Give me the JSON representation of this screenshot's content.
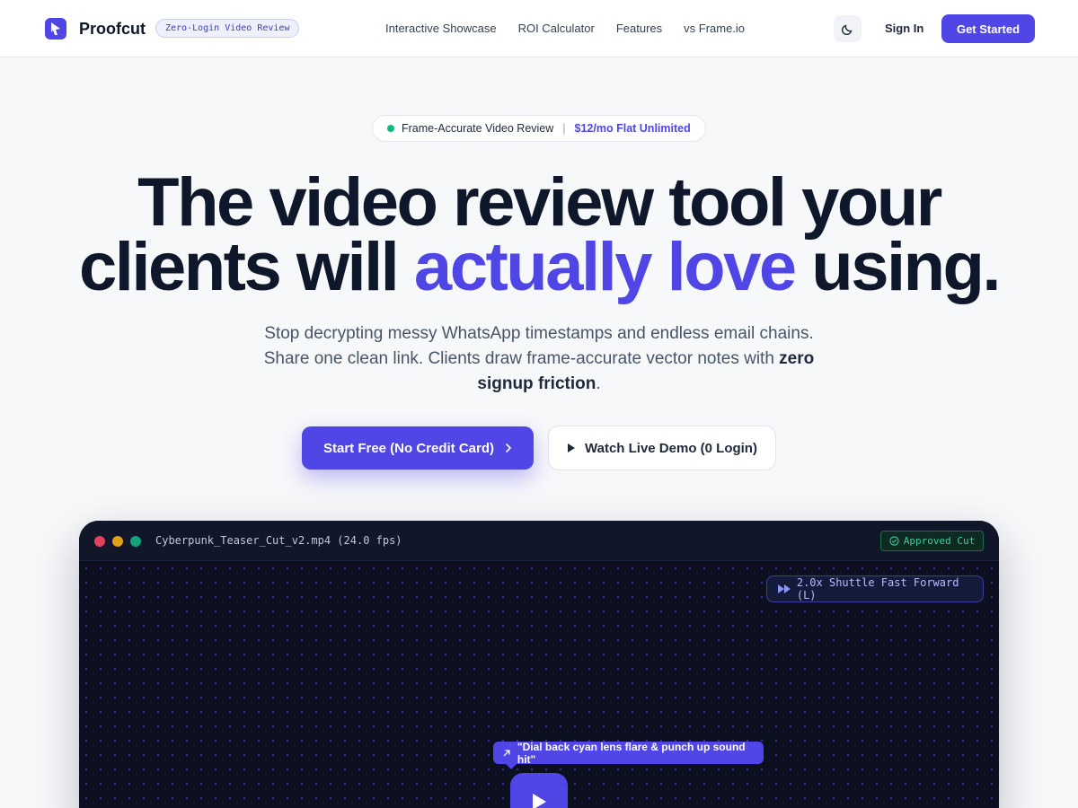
{
  "nav": {
    "brand": "Proofcut",
    "badge": "Zero-Login Video Review",
    "links": [
      "Interactive Showcase",
      "ROI Calculator",
      "Features",
      "vs Frame.io"
    ],
    "sign_in": "Sign In",
    "get_started": "Get Started"
  },
  "hero": {
    "pill_left": "Frame-Accurate Video Review",
    "pill_sep": "|",
    "pill_right": "$12/mo Flat Unlimited",
    "headline_line1": "The video review tool your",
    "headline_pre": "clients will ",
    "headline_accent": "actually love",
    "headline_post": " using.",
    "sub_text": "Stop decrypting messy WhatsApp timestamps and endless email chains. Share one clean link. Clients draw frame-accurate vector notes with ",
    "sub_bold": "zero signup friction",
    "sub_end": ".",
    "cta_primary": "Start Free (No Credit Card)",
    "cta_secondary": "Watch Live Demo (0 Login)"
  },
  "player": {
    "file_name": "Cyberpunk_Teaser_Cut_v2.mp4 (24.0 fps)",
    "approved_label": "Approved Cut",
    "shuttle_label": "2.0x Shuttle Fast Forward (L)",
    "note_label": "\"Dial back cyan lens flare & punch up sound hit\""
  },
  "colors": {
    "accent": "#4f46e5",
    "success": "#10b981",
    "traffic_red": "#e0445b",
    "traffic_yellow": "#e0a21b",
    "traffic_green": "#12a37a"
  },
  "icons": {
    "logo": "play-cursor-icon",
    "theme": "moon-icon",
    "cta_primary": "chevron-right-icon",
    "cta_secondary": "play-icon",
    "approved": "check-circle-icon",
    "shuttle": "fast-forward-icon",
    "note": "arrow-up-right-icon",
    "player": "play-icon"
  }
}
